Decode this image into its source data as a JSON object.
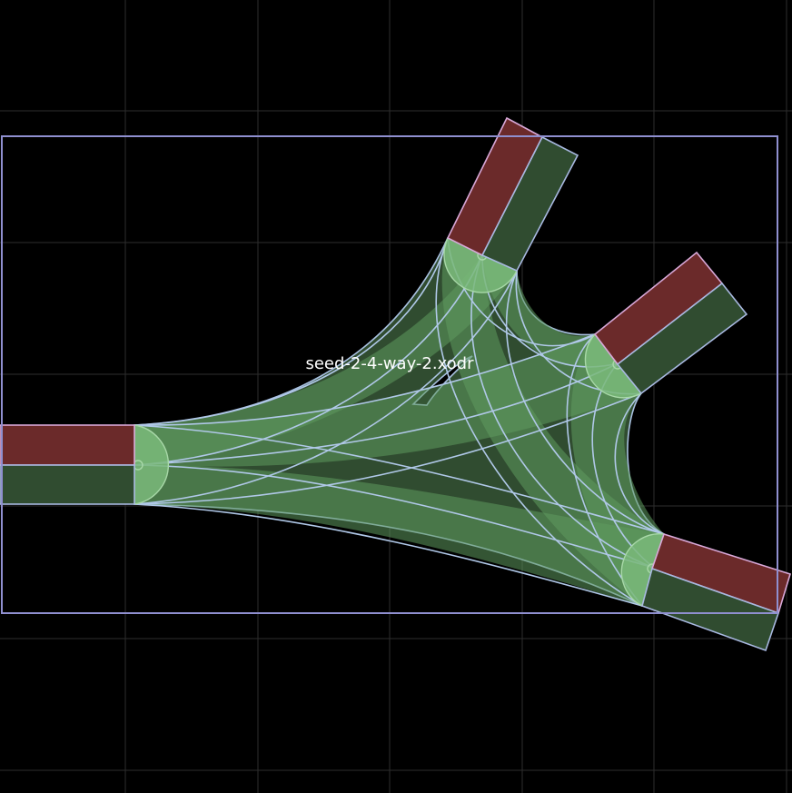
{
  "diagram": {
    "title": "seed-2-4-way-2.xodr"
  },
  "colors": {
    "background": "#000000",
    "grid": "#2e2e2e",
    "bounding_box": "#8f8fcf",
    "incoming_lane": "#6b2a2a",
    "outgoing_lane": "#304c30",
    "junction": "#5e9a5e"
  }
}
